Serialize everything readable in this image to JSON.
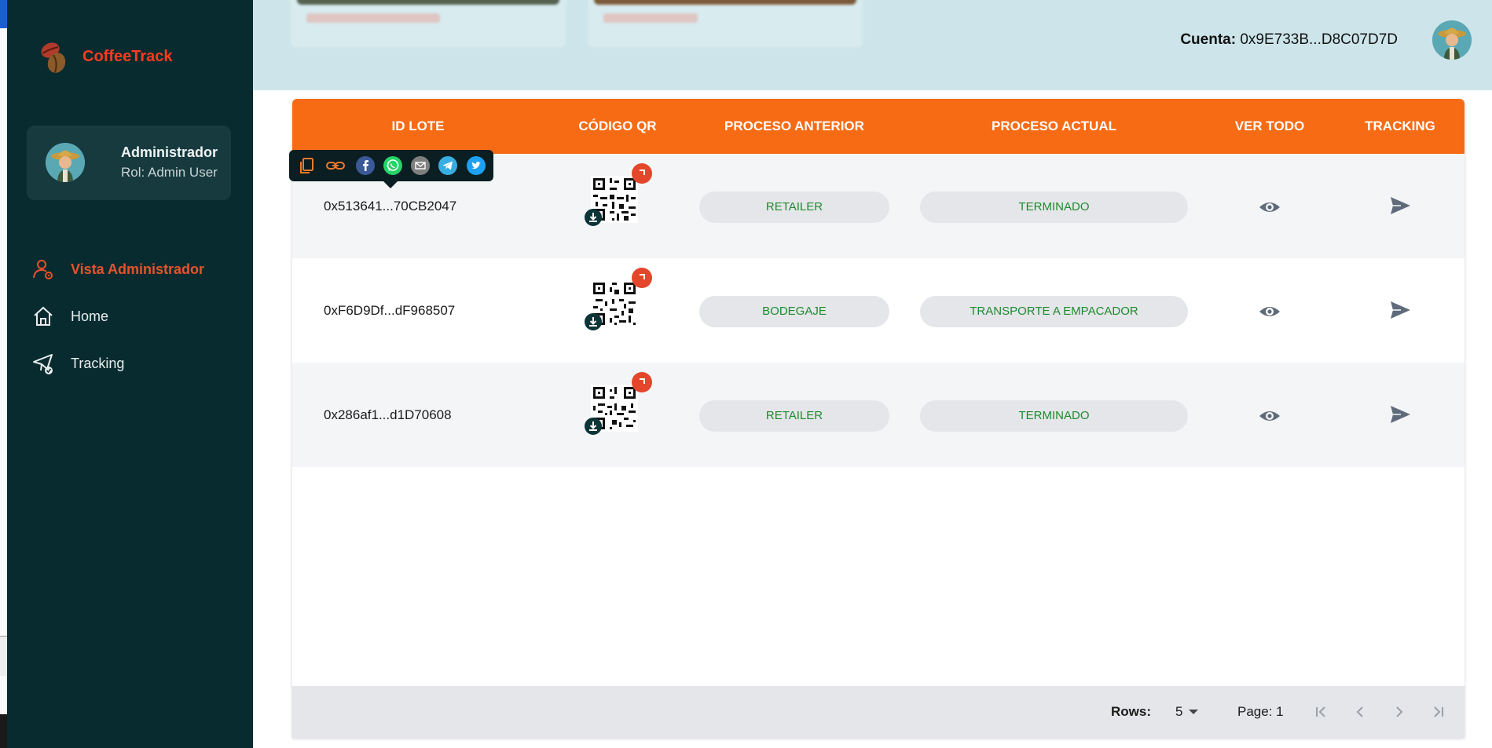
{
  "brand": {
    "name": "CoffeeTrack",
    "logo_icon": "coffee-bean-icon"
  },
  "user": {
    "name": "Administrador",
    "role": "Rol: Admin User"
  },
  "nav": [
    {
      "label": "Vista Administrador",
      "icon": "admin-gear-icon",
      "active": true
    },
    {
      "label": "Home",
      "icon": "home-icon",
      "active": false
    },
    {
      "label": "Tracking",
      "icon": "paper-plane-check-icon",
      "active": false
    }
  ],
  "header": {
    "account_label": "Cuenta:",
    "account_value": "0x9E733B...D8C07D7D"
  },
  "table": {
    "columns": [
      "ID LOTE",
      "CÓDIGO QR",
      "PROCESO ANTERIOR",
      "PROCESO ACTUAL",
      "VER TODO",
      "TRACKING"
    ],
    "rows": [
      {
        "id": "0x513641...70CB2047",
        "prev": "RETAILER",
        "curr": "TERMINADO"
      },
      {
        "id": "0xF6D9Df...dF968507",
        "prev": "BODEGAJE",
        "curr": "TRANSPORTE A EMPACADOR"
      },
      {
        "id": "0x286af1...d1D70608",
        "prev": "RETAILER",
        "curr": "TERMINADO"
      }
    ]
  },
  "share": [
    "copy-icon",
    "link-icon",
    "facebook-icon",
    "whatsapp-icon",
    "email-icon",
    "telegram-icon",
    "twitter-icon"
  ],
  "pagination": {
    "rows_label": "Rows:",
    "rows_value": "5",
    "page_label": "Page: 1"
  },
  "colors": {
    "sidebar_bg": "#082b2f",
    "accent_orange": "#f76b15",
    "active_nav": "#e5532c",
    "brand_red": "#ff3b1f",
    "status_green": "#1f8a2d",
    "topbar_bg": "#cde5ea"
  }
}
